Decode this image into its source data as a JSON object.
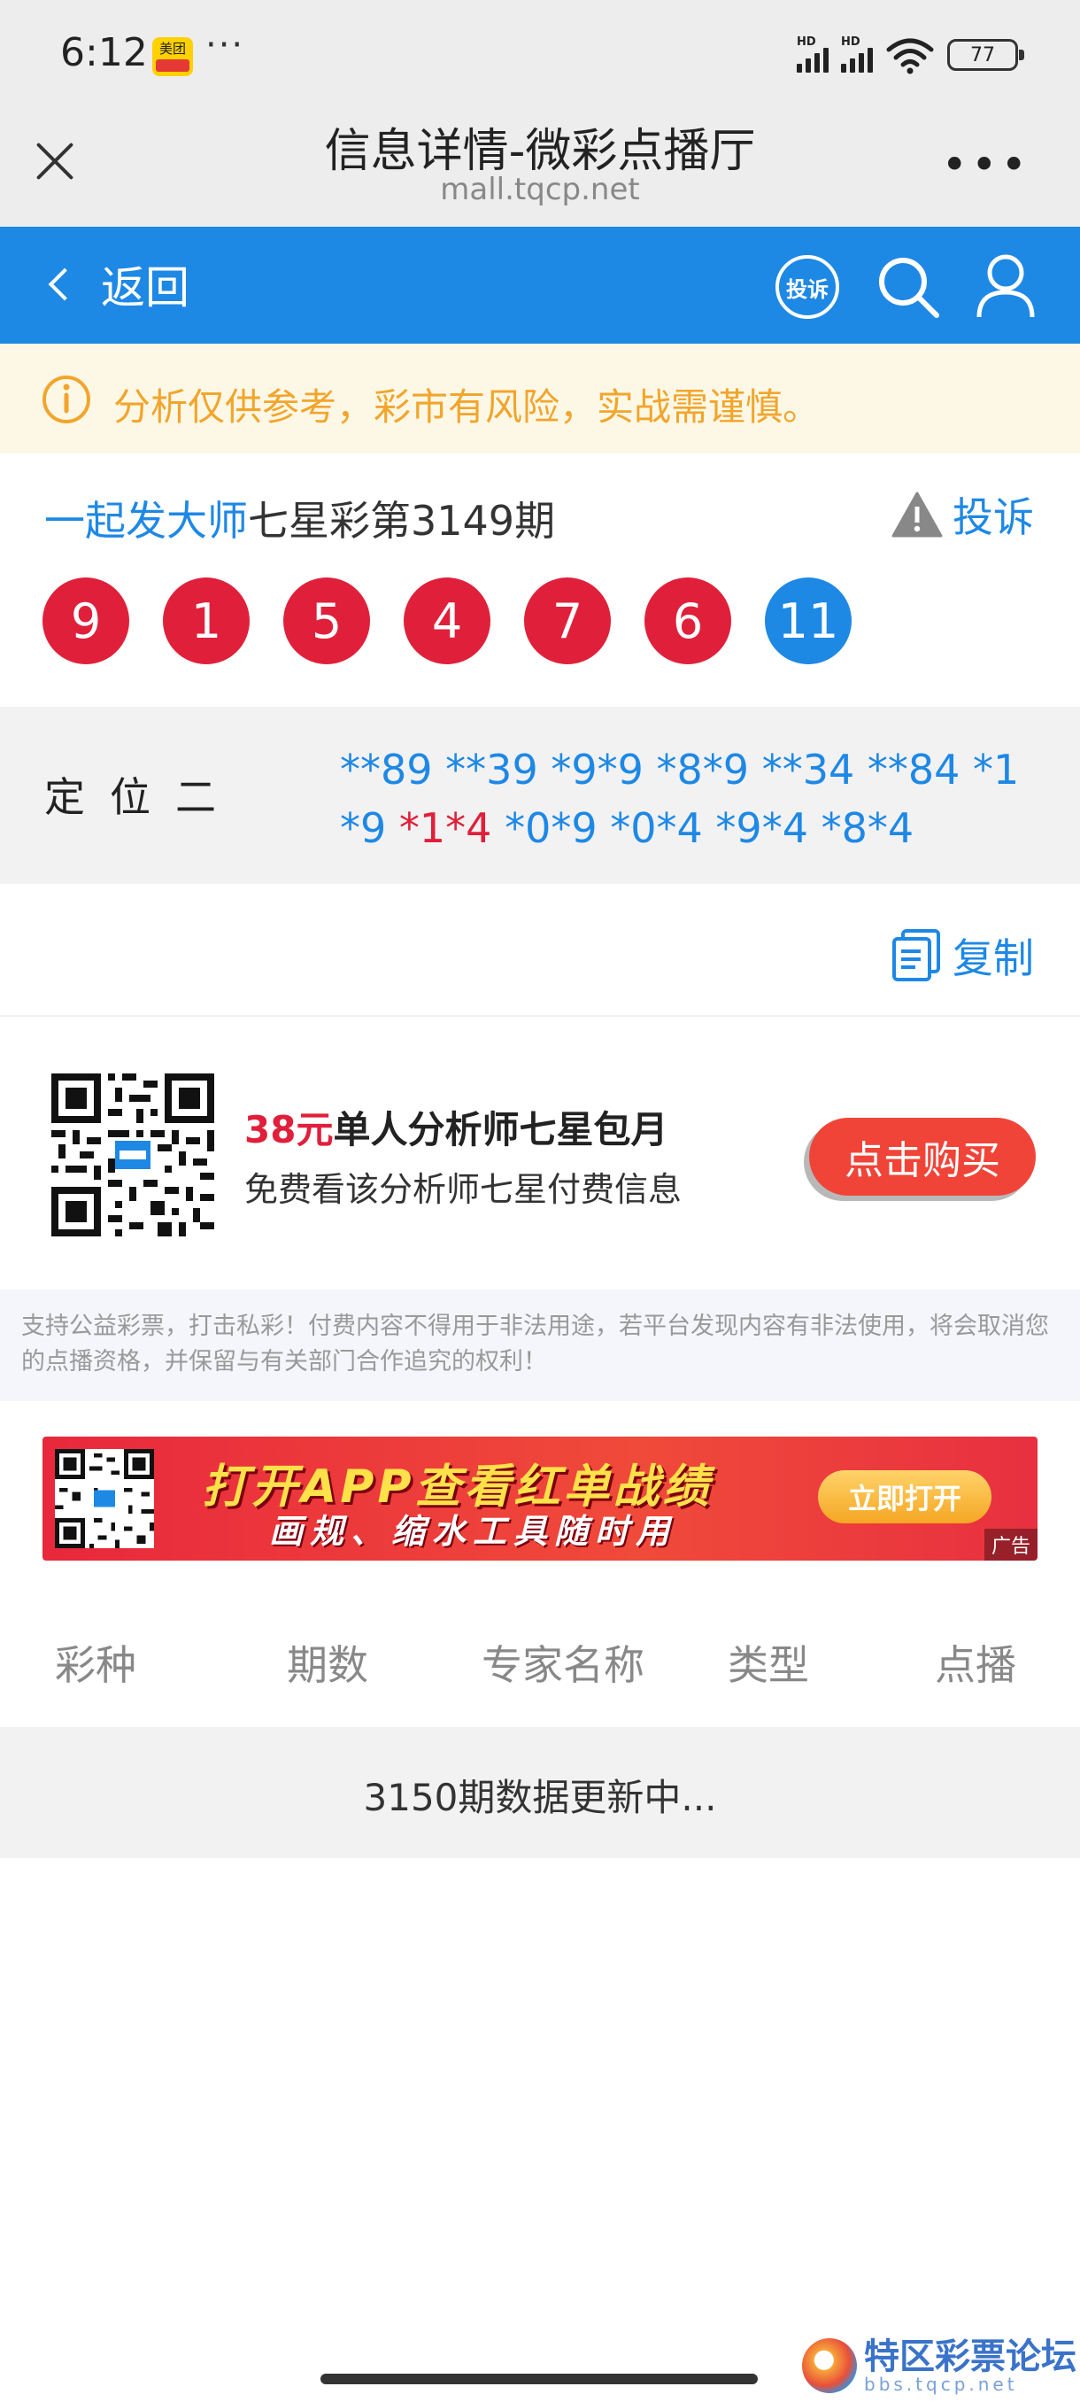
{
  "status_bar": {
    "time": "6:12",
    "app_badge": "美团",
    "app_badge_sub": "",
    "more": "···",
    "hd1": "HD",
    "hd2": "HD",
    "battery": "77"
  },
  "title_bar": {
    "title": "信息详情-微彩点播厅",
    "url": "mall.tqcp.net"
  },
  "nav": {
    "back_label": "返回",
    "complain_icon_label": "投诉"
  },
  "notice": {
    "text": "分析仅供参考，彩市有风险，实战需谨慎。"
  },
  "expert": {
    "name": "一起发大师",
    "issue": "七星彩第3149期",
    "complain_label": "投诉",
    "balls": [
      {
        "value": "9",
        "color": "red"
      },
      {
        "value": "1",
        "color": "red"
      },
      {
        "value": "5",
        "color": "red"
      },
      {
        "value": "4",
        "color": "red"
      },
      {
        "value": "7",
        "color": "red"
      },
      {
        "value": "6",
        "color": "red"
      },
      {
        "value": "11",
        "color": "blue"
      }
    ]
  },
  "positioning": {
    "label": "定位二",
    "numbers": [
      {
        "text": "**89",
        "hit": false
      },
      {
        "text": "**39",
        "hit": false
      },
      {
        "text": "*9*9",
        "hit": false
      },
      {
        "text": "*8*9",
        "hit": false
      },
      {
        "text": "**34",
        "hit": false
      },
      {
        "text": "**84",
        "hit": false
      },
      {
        "text": "*1*9",
        "hit": false
      },
      {
        "text": "*1*4",
        "hit": true
      },
      {
        "text": "*0*9",
        "hit": false
      },
      {
        "text": "*0*4",
        "hit": false
      },
      {
        "text": "*9*4",
        "hit": false
      },
      {
        "text": "*8*4",
        "hit": false
      }
    ]
  },
  "copy": {
    "label": "复制"
  },
  "promo": {
    "price": "38元",
    "title": "单人分析师七星包月",
    "subtitle": "免费看该分析师七星付费信息",
    "buy_label": "点击购买"
  },
  "disclaimer": "支持公益彩票，打击私彩！付费内容不得用于非法用途，若平台发现内容有非法使用，将会取消您的点播资格，并保留与有关部门合作追究的权利！",
  "banner": {
    "line1": "打开APP查看红单战绩",
    "line2": "画规、缩水工具随时用",
    "open_label": "立即打开",
    "ad_label": "广告"
  },
  "table": {
    "headers": [
      "彩种",
      "期数",
      "专家名称",
      "类型",
      "点播"
    ],
    "empty_message": "3150期数据更新中..."
  },
  "watermark": {
    "title": "特区彩票论坛",
    "subtitle": "bbs.tqcp.net"
  },
  "colors": {
    "nav_blue": "#1e88e5",
    "ball_red": "#e0203a",
    "notice_text": "#f2a52c",
    "buy_button": "#f04438"
  }
}
